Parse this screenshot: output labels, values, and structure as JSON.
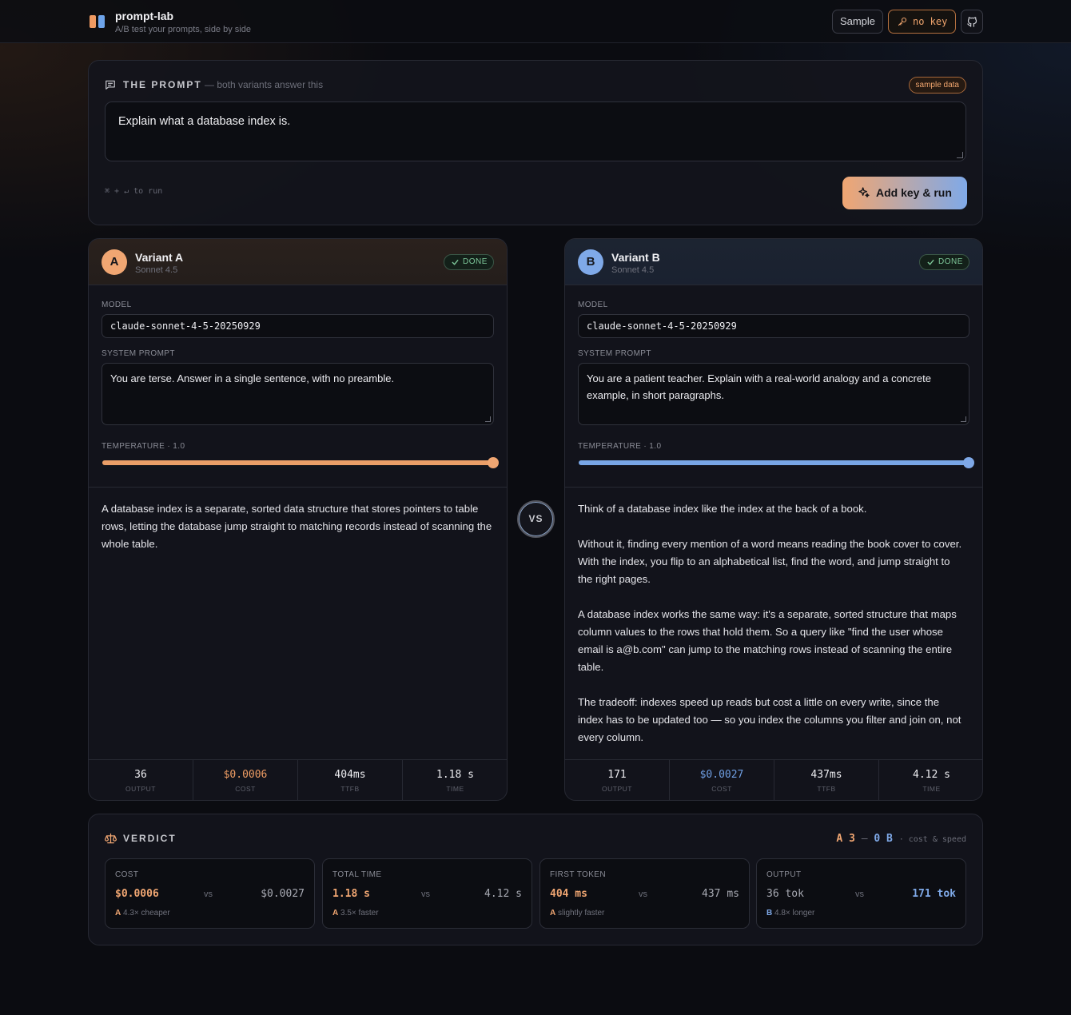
{
  "header": {
    "title": "prompt-lab",
    "subtitle": "A/B test your prompts, side by side",
    "sample_label": "Sample",
    "key_label": "no key"
  },
  "prompt": {
    "section_title": "THE PROMPT",
    "section_sub": "— both variants answer this",
    "badge": "sample data",
    "text": "Explain what a database index is.",
    "hint": "⌘ + ↵ to run",
    "run_label": "Add key & run"
  },
  "variants": [
    {
      "letter": "A",
      "name": "Variant A",
      "model_short": "Sonnet 4.5",
      "status": "DONE",
      "model_label": "MODEL",
      "model": "claude-sonnet-4-5-20250929",
      "system_label": "SYSTEM PROMPT",
      "system_prompt": "You are terse. Answer in a single sentence, with no preamble.",
      "temperature_label": "TEMPERATURE · 1.0",
      "temperature_fraction": 1.0,
      "response": [
        "A database index is a separate, sorted data structure that stores pointers to table rows, letting the database jump straight to matching records instead of scanning the whole table."
      ],
      "stats": [
        {
          "value": "36",
          "label": "OUTPUT"
        },
        {
          "value": "$0.0006",
          "label": "COST"
        },
        {
          "value": "404ms",
          "label": "TTFB"
        },
        {
          "value": "1.18 s",
          "label": "TIME"
        }
      ]
    },
    {
      "letter": "B",
      "name": "Variant B",
      "model_short": "Sonnet 4.5",
      "status": "DONE",
      "model_label": "MODEL",
      "model": "claude-sonnet-4-5-20250929",
      "system_label": "SYSTEM PROMPT",
      "system_prompt": "You are a patient teacher. Explain with a real-world analogy and a concrete example, in short paragraphs.",
      "temperature_label": "TEMPERATURE · 1.0",
      "temperature_fraction": 1.0,
      "response": [
        "Think of a database index like the index at the back of a book.",
        "Without it, finding every mention of a word means reading the book cover to cover. With the index, you flip to an alphabetical list, find the word, and jump straight to the right pages.",
        "A database index works the same way: it's a separate, sorted structure that maps column values to the rows that hold them. So a query like \"find the user whose email is a@b.com\" can jump to the matching rows instead of scanning the entire table.",
        "The tradeoff: indexes speed up reads but cost a little on every write, since the index has to be updated too — so you index the columns you filter and join on, not every column."
      ],
      "stats": [
        {
          "value": "171",
          "label": "OUTPUT"
        },
        {
          "value": "$0.0027",
          "label": "COST"
        },
        {
          "value": "437ms",
          "label": "TTFB"
        },
        {
          "value": "4.12 s",
          "label": "TIME"
        }
      ]
    }
  ],
  "vs_label": "VS",
  "verdict": {
    "title": "VERDICT",
    "score_a": "A 3",
    "score_dash": "—",
    "score_b": "0 B",
    "score_tag": "· cost & speed",
    "items": [
      {
        "label": "COST",
        "a": "$0.0006",
        "vs": "vs",
        "b": "$0.0027",
        "winner": "A",
        "note": "4.3× cheaper"
      },
      {
        "label": "TOTAL TIME",
        "a": "1.18 s",
        "vs": "vs",
        "b": "4.12 s",
        "winner": "A",
        "note": "3.5× faster"
      },
      {
        "label": "FIRST TOKEN",
        "a": "404 ms",
        "vs": "vs",
        "b": "437 ms",
        "winner": "A",
        "note": "slightly faster"
      },
      {
        "label": "OUTPUT",
        "a": "36 tok",
        "vs": "vs",
        "b": "171 tok",
        "winner": "B",
        "note": "4.8× longer"
      }
    ]
  },
  "colors": {
    "accent_a": "#f0a672",
    "accent_b": "#7fa9e8",
    "done": "#7fc99b",
    "background": "#0b0c11"
  }
}
